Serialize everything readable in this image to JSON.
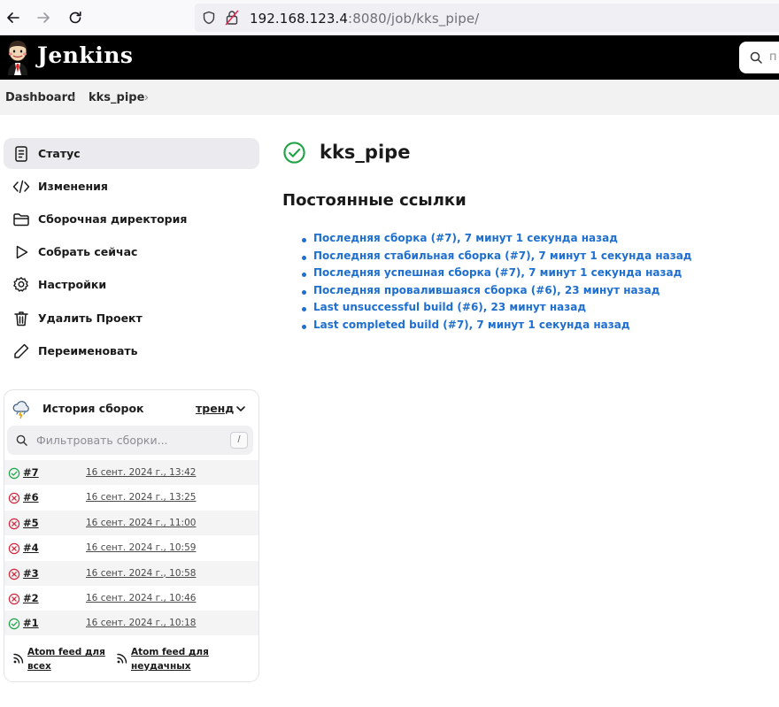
{
  "browser": {
    "url_host": "192.168.123.4",
    "url_rest": ":8080/job/kks_pipe/"
  },
  "header": {
    "brand": "Jenkins",
    "search_placeholder": "п"
  },
  "breadcrumb": [
    "Dashboard",
    "kks_pipe"
  ],
  "sidebar": {
    "items": [
      {
        "label": "Статус",
        "icon": "document-icon"
      },
      {
        "label": "Изменения",
        "icon": "code-icon"
      },
      {
        "label": "Сборочная директория",
        "icon": "folder-icon"
      },
      {
        "label": "Собрать сейчас",
        "icon": "play-icon"
      },
      {
        "label": "Настройки",
        "icon": "gear-icon"
      },
      {
        "label": "Удалить Проект",
        "icon": "trash-icon"
      },
      {
        "label": "Переименовать",
        "icon": "pencil-icon"
      }
    ]
  },
  "build_history": {
    "title": "История сборок",
    "trend_label": "тренд",
    "filter_placeholder": "Фильтровать сборки...",
    "filter_shortcut": "/",
    "builds": [
      {
        "number": "#7",
        "date": "16 сент. 2024 г., 13:42",
        "status": "success"
      },
      {
        "number": "#6",
        "date": "16 сент. 2024 г., 13:25",
        "status": "failed"
      },
      {
        "number": "#5",
        "date": "16 сент. 2024 г., 11:00",
        "status": "failed"
      },
      {
        "number": "#4",
        "date": "16 сент. 2024 г., 10:59",
        "status": "failed"
      },
      {
        "number": "#3",
        "date": "16 сент. 2024 г., 10:58",
        "status": "failed"
      },
      {
        "number": "#2",
        "date": "16 сент. 2024 г., 10:46",
        "status": "failed"
      },
      {
        "number": "#1",
        "date": "16 сент. 2024 г., 10:18",
        "status": "success"
      }
    ],
    "feed_all": [
      "Atom feed для",
      "всех"
    ],
    "feed_failed": [
      "Atom feed для",
      "неудачных"
    ]
  },
  "main": {
    "job_name": "kks_pipe",
    "permalinks_heading": "Постоянные ссылки",
    "permalinks": [
      "Последняя сборка (#7), 7 минут 1 секунда назад",
      "Последняя стабильная сборка (#7), 7 минут 1 секунда назад",
      "Последняя успешная сборка (#7), 7 минут 1 секунда назад",
      "Последняя провалившаяся сборка (#6), 23 минут назад",
      "Last unsuccessful build (#6), 23 минут назад",
      "Last completed build (#7), 7 минут 1 секунда назад"
    ]
  },
  "colors": {
    "success": "#1ea446",
    "failed": "#d2263a",
    "link": "#1e6fcf"
  }
}
